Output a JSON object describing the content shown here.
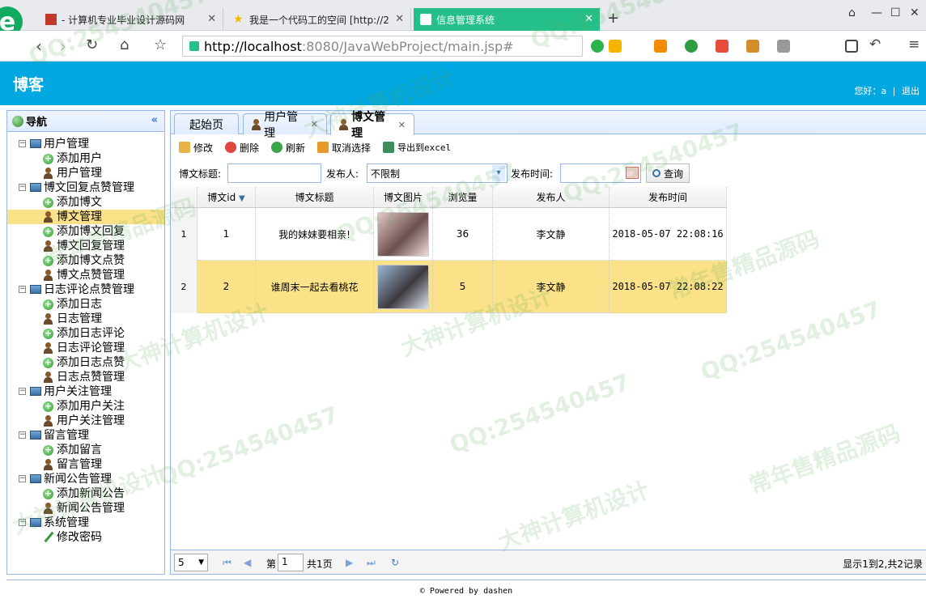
{
  "browser": {
    "tabs": [
      {
        "title": "- 计算机专业毕业设计源码网"
      },
      {
        "title": "我是一个代码工的空间 [http://2"
      },
      {
        "title": "信息管理系统"
      }
    ],
    "url_host": "http://localhost",
    "url_rest": ":8080/JavaWebProject/main.jsp#"
  },
  "header": {
    "title": "博客",
    "greeting": "您好：a",
    "logout": "退出"
  },
  "sidebar": {
    "title": "导航",
    "groups": [
      {
        "label": "用户管理",
        "items": [
          "添加用户",
          "用户管理"
        ]
      },
      {
        "label": "博文回复点赞管理",
        "items": [
          "添加博文",
          "博文管理",
          "添加博文回复",
          "博文回复管理",
          "添加博文点赞",
          "博文点赞管理"
        ]
      },
      {
        "label": "日志评论点赞管理",
        "items": [
          "添加日志",
          "日志管理",
          "添加日志评论",
          "日志评论管理",
          "添加日志点赞",
          "日志点赞管理"
        ]
      },
      {
        "label": "用户关注管理",
        "items": [
          "添加用户关注",
          "用户关注管理"
        ]
      },
      {
        "label": "留言管理",
        "items": [
          "添加留言",
          "留言管理"
        ]
      },
      {
        "label": "新闻公告管理",
        "items": [
          "添加新闻公告",
          "新闻公告管理"
        ]
      },
      {
        "label": "系统管理",
        "items": [
          "修改密码"
        ]
      }
    ]
  },
  "tabs": [
    "起始页",
    "用户管理",
    "博文管理"
  ],
  "actions": [
    "修改",
    "删除",
    "刷新",
    "取消选择",
    "导出到excel"
  ],
  "search": {
    "title_label": "博文标题:",
    "publisher_label": "发布人:",
    "publisher_value": "不限制",
    "time_label": "发布时间:",
    "query_button": "查询"
  },
  "grid": {
    "columns": [
      "博文id",
      "博文标题",
      "博文图片",
      "浏览量",
      "发布人",
      "发布时间"
    ],
    "rows": [
      {
        "num": "1",
        "id": "1",
        "title": "我的妹妹要相亲!",
        "views": "36",
        "publisher": "李文静",
        "time": "2018-05-07 22:08:16"
      },
      {
        "num": "2",
        "id": "2",
        "title": "谁周末一起去看桃花",
        "views": "5",
        "publisher": "李文静",
        "time": "2018-05-07 22:08:22"
      }
    ]
  },
  "pager": {
    "page_size": "5",
    "page_label_pre": "第",
    "page_value": "1",
    "page_label_post": "共1页",
    "info": "显示1到2,共2记录"
  },
  "footer": "© Powered by dashen",
  "watermarks": [
    "QQ:254540457",
    "常年售精品源码",
    "大神计算机设计"
  ],
  "colors": {
    "header": "#00a7e0",
    "active_tab": "#25c08a",
    "selected_row": "#fbe187",
    "border": "#95b8e7"
  }
}
